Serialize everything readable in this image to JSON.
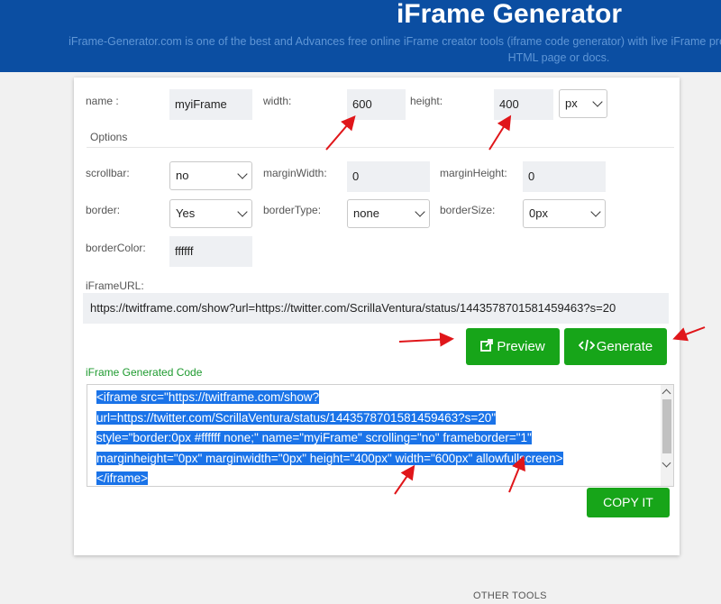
{
  "header": {
    "title": "iFrame Generator",
    "subtitle": "iFrame-Generator.com is one of the best and Advances free online iFrame creator tools (iframe code generator) with live iFrame preview feature for Web Designers to embed any online page to any HTML page or docs."
  },
  "form": {
    "name_label": "name :",
    "name_value": "myiFrame",
    "width_label": "width:",
    "width_value": "600",
    "height_label": "height:",
    "height_value": "400",
    "unit_value": "px",
    "options_label": "Options",
    "scrollbar_label": "scrollbar:",
    "scrollbar_value": "no",
    "margin_width_label": "marginWidth:",
    "margin_width_value": "0",
    "margin_height_label": "marginHeight:",
    "margin_height_value": "0",
    "border_label": "border:",
    "border_value": "Yes",
    "border_type_label": "borderType:",
    "border_type_value": "none",
    "border_size_label": "borderSize:",
    "border_size_value": "0px",
    "border_color_label": "borderColor:",
    "border_color_value": "ffffff",
    "url_label": "iFrameURL:",
    "url_value": "https://twitframe.com/show?url=https://twitter.com/ScrillaVentura/status/1443578701581459463?s=20"
  },
  "buttons": {
    "preview": "Preview",
    "generate": "Generate",
    "copy": "COPY IT"
  },
  "code": {
    "label": "iFrame Generated Code",
    "lines": [
      "<iframe src=\"https://twitframe.com/show?",
      "url=https://twitter.com/ScrillaVentura/status/1443578701581459463?s=20\"",
      "style=\"border:0px #ffffff none;\" name=\"myiFrame\" scrolling=\"no\" frameborder=\"1\"",
      "marginheight=\"0px\" marginwidth=\"0px\" height=\"400px\" width=\"600px\" allowfullscreen>",
      "</iframe>"
    ]
  },
  "footer": {
    "other_tools": "OTHER TOOLS"
  },
  "colors": {
    "header_bg": "#0b4ea2",
    "button_green": "#17a519",
    "label_green": "#1e9a2f",
    "annotation_red": "#e0161a",
    "highlight_blue": "#1a73e8"
  },
  "icons": [
    "preview-icon",
    "code-icon"
  ]
}
